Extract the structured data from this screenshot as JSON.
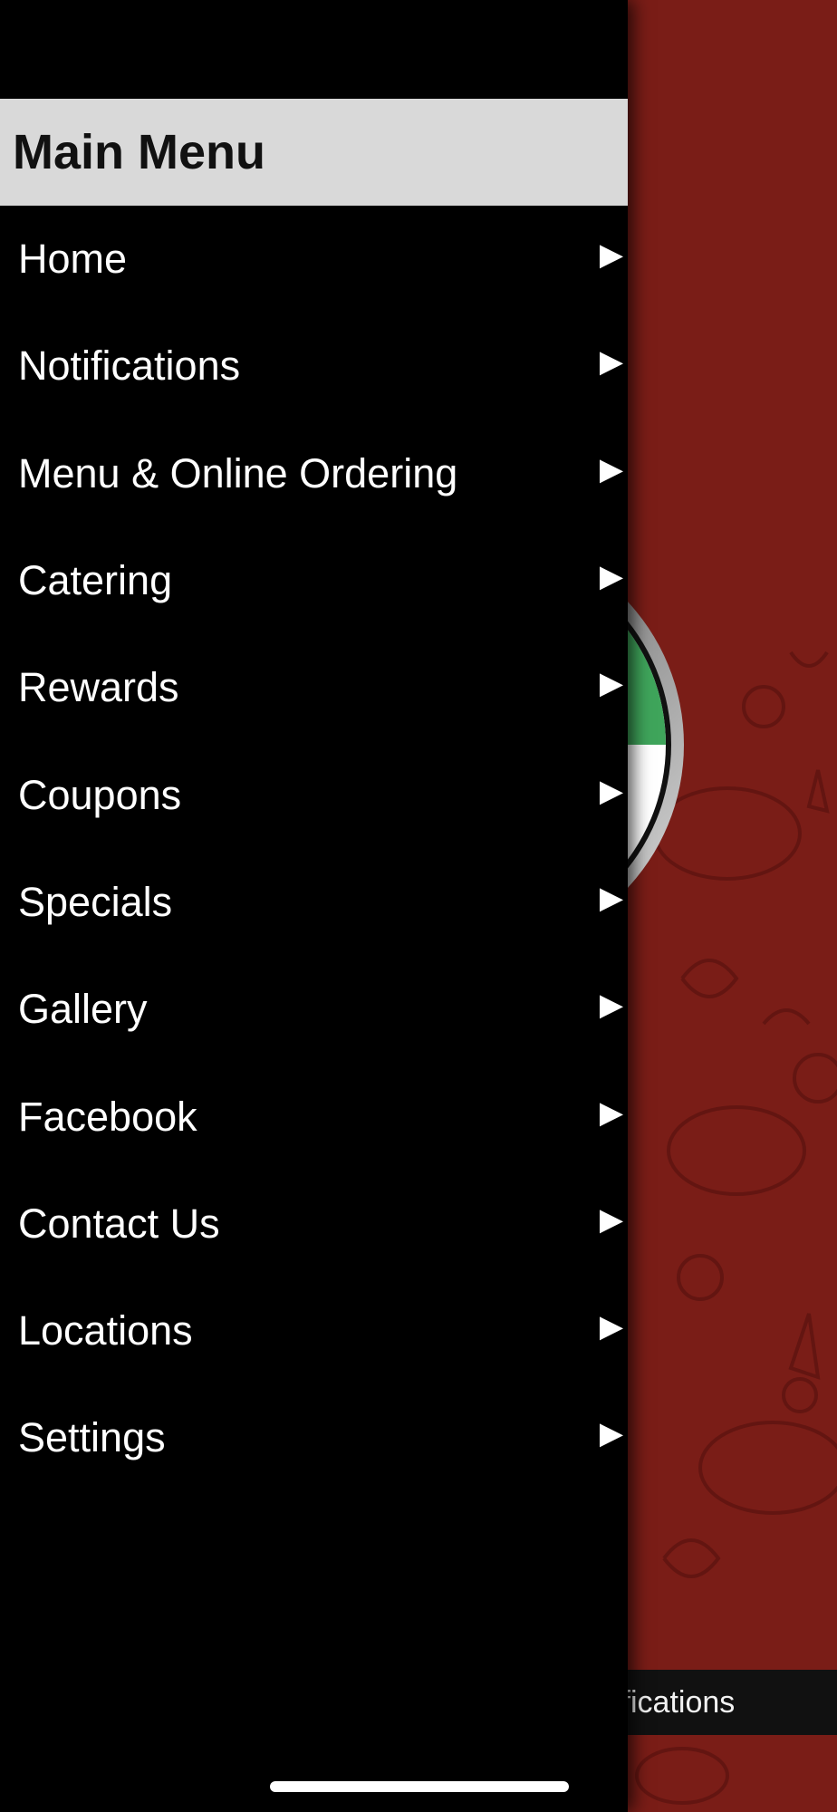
{
  "drawer": {
    "title": "Main Menu",
    "items": [
      {
        "label": "Home",
        "icon": "chevron-right-icon"
      },
      {
        "label": "Notifications",
        "icon": "chevron-right-icon"
      },
      {
        "label": "Menu & Online Ordering",
        "icon": "chevron-right-icon"
      },
      {
        "label": "Catering",
        "icon": "chevron-right-icon"
      },
      {
        "label": "Rewards",
        "icon": "chevron-right-icon"
      },
      {
        "label": "Coupons",
        "icon": "chevron-right-icon"
      },
      {
        "label": "Specials",
        "icon": "chevron-right-icon"
      },
      {
        "label": "Gallery",
        "icon": "chevron-right-icon"
      },
      {
        "label": "Facebook",
        "icon": "chevron-right-icon"
      },
      {
        "label": "Contact Us",
        "icon": "chevron-right-icon"
      },
      {
        "label": "Locations",
        "icon": "chevron-right-icon"
      },
      {
        "label": "Settings",
        "icon": "chevron-right-icon"
      }
    ]
  },
  "background_app": {
    "bottom_bar_label": "ifications",
    "logo_icon": "restaurant-logo-icon"
  },
  "colors": {
    "drawer_bg": "#000000",
    "header_bg": "#d9d9d9",
    "app_bg": "#7a1d17",
    "logo_green": "#3fa55b"
  }
}
